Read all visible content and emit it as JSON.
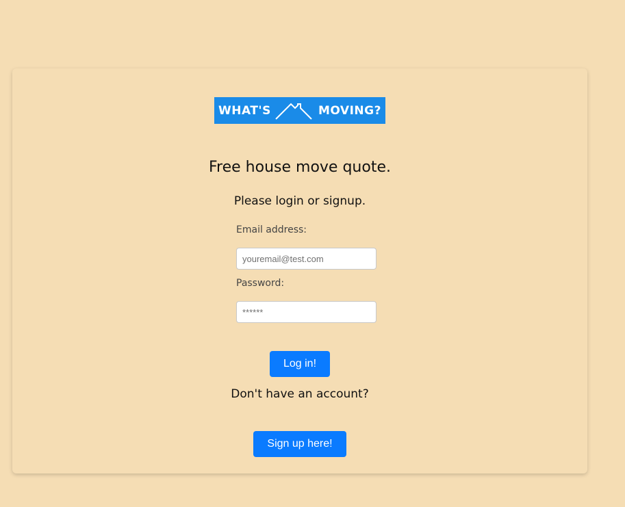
{
  "brand": {
    "logo_left": "WHAT'S",
    "logo_right": "MOVING?",
    "logo_color": "#1a8be8"
  },
  "heading": "Free house move quote.",
  "subheading": "Please login or signup.",
  "form": {
    "email_label": "Email address:",
    "email_placeholder": "youremail@test.com",
    "email_value": "",
    "password_label": "Password:",
    "password_placeholder": "******",
    "password_value": "",
    "login_button": "Log in!"
  },
  "signup": {
    "prompt": "Don't have an account?",
    "button": "Sign up here!"
  },
  "colors": {
    "background": "#f5ddb4",
    "button": "#0a7bff"
  }
}
